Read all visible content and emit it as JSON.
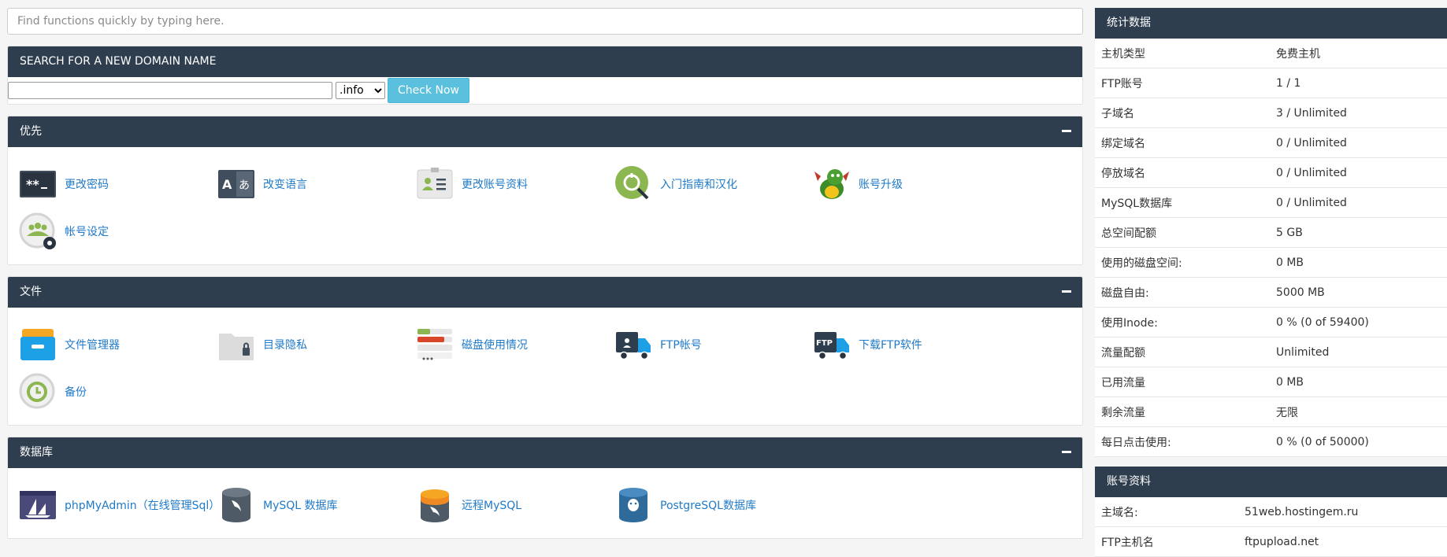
{
  "search": {
    "placeholder": "Find functions quickly by typing here."
  },
  "domain": {
    "title": "SEARCH FOR A NEW DOMAIN NAME",
    "tld": ".info",
    "button": "Check Now"
  },
  "priority": {
    "title": "优先",
    "items": [
      {
        "label": "更改密码",
        "icon": "password-icon"
      },
      {
        "label": "改变语言",
        "icon": "language-icon"
      },
      {
        "label": "更改账号资料",
        "icon": "contact-card-icon"
      },
      {
        "label": "入门指南和汉化",
        "icon": "getting-started-icon"
      },
      {
        "label": "账号升级",
        "icon": "dragon-icon"
      },
      {
        "label": "帐号设定",
        "icon": "account-settings-icon"
      }
    ]
  },
  "files": {
    "title": "文件",
    "items": [
      {
        "label": "文件管理器",
        "icon": "file-manager-icon"
      },
      {
        "label": "目录隐私",
        "icon": "folder-lock-icon"
      },
      {
        "label": "磁盘使用情况",
        "icon": "disk-usage-icon"
      },
      {
        "label": "FTP帐号",
        "icon": "ftp-truck-icon"
      },
      {
        "label": "下载FTP软件",
        "icon": "ftp-download-icon"
      },
      {
        "label": "备份",
        "icon": "backup-icon"
      }
    ]
  },
  "databases": {
    "title": "数据库",
    "items": [
      {
        "label": "phpMyAdmin（在线管理Sql）",
        "icon": "phpmyadmin-icon"
      },
      {
        "label": "MySQL 数据库",
        "icon": "mysql-icon"
      },
      {
        "label": "远程MySQL",
        "icon": "remote-mysql-icon"
      },
      {
        "label": "PostgreSQL数据库",
        "icon": "postgresql-icon"
      }
    ]
  },
  "stats": {
    "title": "统计数据",
    "rows": [
      {
        "k": "主机类型",
        "v": "免费主机"
      },
      {
        "k": "FTP账号",
        "v": "1 / 1"
      },
      {
        "k": "子域名",
        "v": "3 / Unlimited"
      },
      {
        "k": "绑定域名",
        "v": "0 / Unlimited"
      },
      {
        "k": "停放域名",
        "v": "0 / Unlimited"
      },
      {
        "k": "MySQL数据库",
        "v": "0 / Unlimited"
      },
      {
        "k": "总空间配额",
        "v": "5 GB"
      },
      {
        "k": "使用的磁盘空间:",
        "v": "0 MB"
      },
      {
        "k": "磁盘自由:",
        "v": "5000 MB"
      },
      {
        "k": "使用Inode:",
        "v": "0 % (0 of 59400)"
      },
      {
        "k": "流量配额",
        "v": "Unlimited"
      },
      {
        "k": "已用流量",
        "v": "0 MB"
      },
      {
        "k": "剩余流量",
        "v": "无限"
      },
      {
        "k": "每日点击使用:",
        "v": "0 % (0 of 50000)"
      }
    ]
  },
  "account": {
    "title": "账号资料",
    "rows": [
      {
        "k": "主域名:",
        "v": "51web.hostingem.ru"
      },
      {
        "k": "FTP主机名",
        "v": "ftpupload.net"
      }
    ]
  },
  "colors": {
    "header": "#2f3e4e",
    "link": "#1f7ac7",
    "button": "#5bc0de"
  }
}
